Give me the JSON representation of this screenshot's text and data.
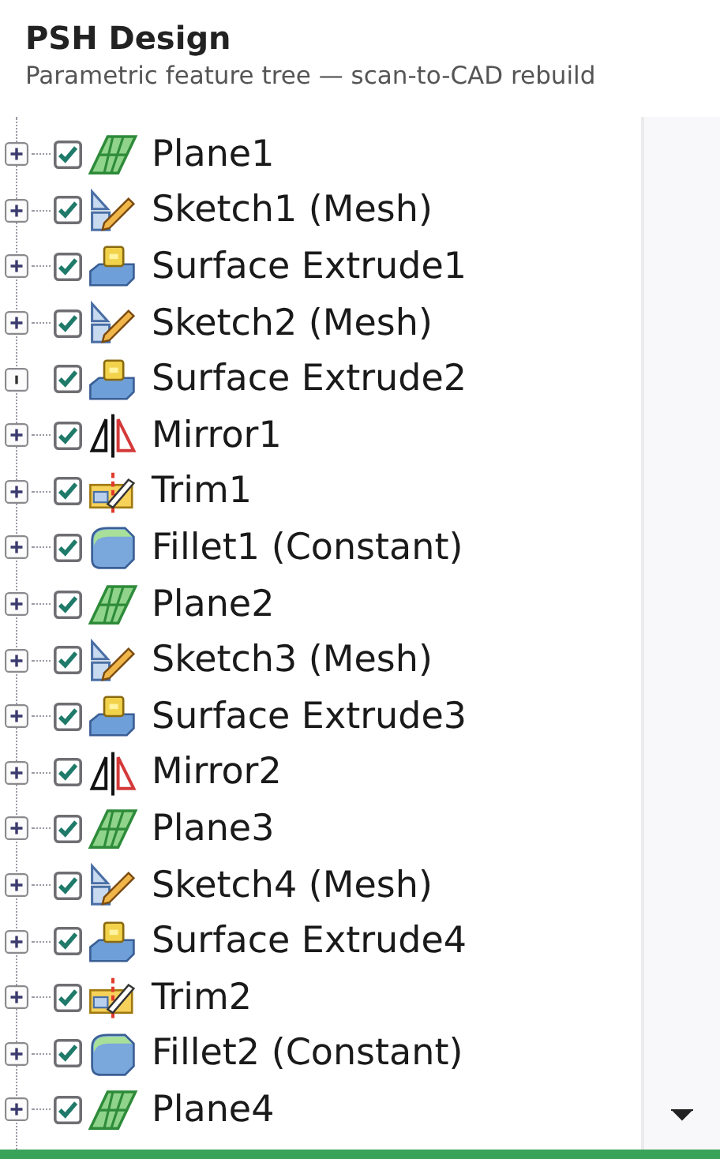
{
  "header": {
    "title": "PSH Design",
    "subtitle": "Parametric feature tree — scan-to-CAD rebuild"
  },
  "rows": [
    {
      "label": "Plane1",
      "kind": "plane",
      "checked": true,
      "expanded": false
    },
    {
      "label": "Sketch1 (Mesh)",
      "kind": "sketch",
      "checked": true,
      "expanded": false
    },
    {
      "label": "Surface Extrude1",
      "kind": "extrude",
      "checked": true,
      "expanded": false
    },
    {
      "label": "Sketch2 (Mesh)",
      "kind": "sketch",
      "checked": true,
      "expanded": false
    },
    {
      "label": "Surface Extrude2",
      "kind": "extrude",
      "checked": true,
      "expanded": true
    },
    {
      "label": "Mirror1",
      "kind": "mirror",
      "checked": true,
      "expanded": false
    },
    {
      "label": "Trim1",
      "kind": "trim",
      "checked": true,
      "expanded": false
    },
    {
      "label": "Fillet1 (Constant)",
      "kind": "fillet",
      "checked": true,
      "expanded": false
    },
    {
      "label": "Plane2",
      "kind": "plane",
      "checked": true,
      "expanded": false
    },
    {
      "label": "Sketch3 (Mesh)",
      "kind": "sketch",
      "checked": true,
      "expanded": false
    },
    {
      "label": "Surface Extrude3",
      "kind": "extrude",
      "checked": true,
      "expanded": false
    },
    {
      "label": "Mirror2",
      "kind": "mirror",
      "checked": true,
      "expanded": false
    },
    {
      "label": "Plane3",
      "kind": "plane",
      "checked": true,
      "expanded": false
    },
    {
      "label": "Sketch4 (Mesh)",
      "kind": "sketch",
      "checked": true,
      "expanded": false
    },
    {
      "label": "Surface Extrude4",
      "kind": "extrude",
      "checked": true,
      "expanded": false
    },
    {
      "label": "Trim2",
      "kind": "trim",
      "checked": true,
      "expanded": false
    },
    {
      "label": "Fillet2 (Constant)",
      "kind": "fillet",
      "checked": true,
      "expanded": false
    },
    {
      "label": "Plane4",
      "kind": "plane",
      "checked": true,
      "expanded": false
    }
  ]
}
